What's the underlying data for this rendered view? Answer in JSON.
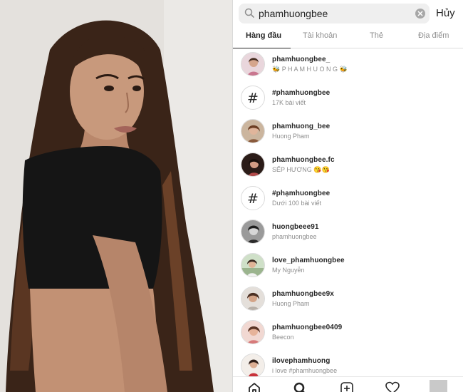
{
  "search": {
    "query": "phamhuongbee",
    "cancel_label": "Hủy"
  },
  "tabs": [
    {
      "label": "Hàng đầu",
      "active": true
    },
    {
      "label": "Tài khoản",
      "active": false
    },
    {
      "label": "Thẻ",
      "active": false
    },
    {
      "label": "Địa điểm",
      "active": false
    }
  ],
  "results": [
    {
      "kind": "account",
      "name": "phamhuongbee_",
      "subtitle": "🐝 P H A M H U O N G 🐝"
    },
    {
      "kind": "hashtag",
      "name": "#phamhuongbee",
      "subtitle": "17K bài viết"
    },
    {
      "kind": "account",
      "name": "phamhuong_bee",
      "subtitle": "Huong Pham"
    },
    {
      "kind": "account",
      "name": "phamhuongbee.fc",
      "subtitle": "SẾP HƯƠNG 😘😘"
    },
    {
      "kind": "hashtag",
      "name": "#phạmhuongbee",
      "subtitle": "Dưới 100 bài viết"
    },
    {
      "kind": "account",
      "name": "huongbeee91",
      "subtitle": "phamhuongbee"
    },
    {
      "kind": "account",
      "name": "love_phamhuongbee",
      "subtitle": "My Nguyễn"
    },
    {
      "kind": "account",
      "name": "phamhuongbee9x",
      "subtitle": "Huong Pham"
    },
    {
      "kind": "account",
      "name": "phamhuongbee0409",
      "subtitle": "Beecon"
    },
    {
      "kind": "account",
      "name": "ilovephamhuong",
      "subtitle": "i love #phamhuongbee"
    }
  ],
  "icons": {
    "search": "search-icon",
    "clear": "clear-icon",
    "hashtag": "#",
    "nav": [
      "home-icon",
      "explore-search-icon",
      "new-post-icon",
      "heart-icon",
      "profile-icon"
    ]
  },
  "colors": {
    "text_primary": "#262626",
    "text_secondary": "#8e8e8e",
    "search_bg": "#efefef",
    "border": "#dbdbdb"
  }
}
